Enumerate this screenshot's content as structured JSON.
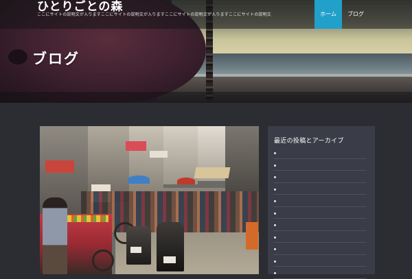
{
  "header": {
    "site_title": "ひとりごとの森",
    "site_description": "ここにサイトの説明文が入りますここにサイトの説明文が入りますここにサイトの説明文が入りますここにサイトの説明文",
    "nav": [
      {
        "label": "ホーム",
        "active": true
      },
      {
        "label": "ブログ",
        "active": false
      }
    ]
  },
  "hero": {
    "page_title": "ブログ"
  },
  "main": {
    "featured_image": "street-market-photo"
  },
  "sidebar": {
    "widget_title": "最近の投稿とアーカイブ",
    "items": [
      "",
      "",
      "",
      "",
      "",
      "",
      "",
      "",
      "",
      "",
      ""
    ]
  },
  "colors": {
    "accent": "#21a0c9",
    "page_background": "#2b2d33",
    "sidebar_background": "#3a3d47"
  }
}
